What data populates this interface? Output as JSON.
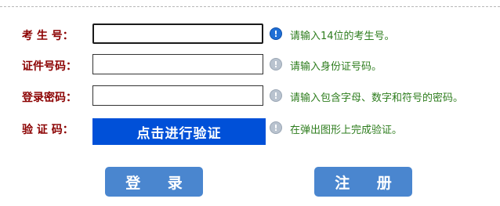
{
  "form": {
    "rows": [
      {
        "label": "考 生 号：",
        "value": "",
        "hint": "请输入14位的考生号。"
      },
      {
        "label": "证件号码：",
        "value": "",
        "hint": "请输入身份证号码。"
      },
      {
        "label": "登录密码：",
        "value": "",
        "hint": "请输入包含字母、数字和符号的密码。"
      },
      {
        "label": "验 证 码：",
        "verify_button": "点击进行验证",
        "hint": "在弹出图形上完成验证。"
      }
    ]
  },
  "hint_icon_glyph": "!",
  "actions": {
    "login": "登 录",
    "register": "注 册"
  },
  "colors": {
    "label": "#8b0000",
    "hint": "#2e7d1e",
    "verify_button": "#0050d8",
    "action_button": "#4a86cf",
    "active_icon": "#1f6fd6",
    "inactive_icon": "#b9c3cf"
  }
}
